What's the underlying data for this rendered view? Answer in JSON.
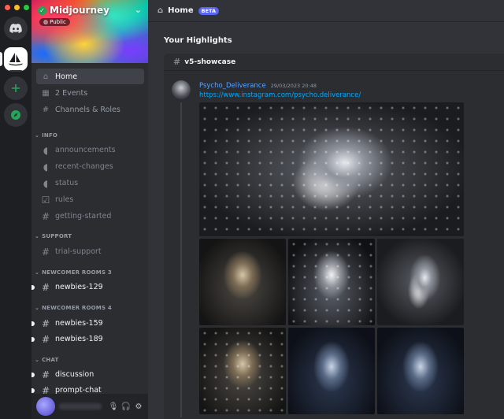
{
  "server": {
    "name": "Midjourney",
    "visibility": "Public"
  },
  "nav": [
    {
      "label": "Home"
    },
    {
      "label": "2 Events"
    },
    {
      "label": "Channels & Roles"
    }
  ],
  "categories": {
    "info": "INFO",
    "support": "SUPPORT",
    "newcomer3": "NEWCOMER ROOMS 3",
    "newcomer4": "NEWCOMER ROOMS 4",
    "chat": "CHAT"
  },
  "channels": {
    "announcements": "announcements",
    "recent_changes": "recent-changes",
    "status": "status",
    "rules": "rules",
    "getting_started": "getting-started",
    "trial_support": "trial-support",
    "newbies_129": "newbies-129",
    "newbies_159": "newbies-159",
    "newbies_189": "newbies-189",
    "discussion": "discussion",
    "prompt_chat": "prompt-chat"
  },
  "topbar": {
    "title": "Home",
    "badge": "BETA"
  },
  "highlights": {
    "title": "Your Highlights",
    "channel": "v5-showcase",
    "message": {
      "author": "Psycho_Deliverance",
      "timestamp": "29/03/2023 20:48",
      "link": "https://www.instagram.com/psycho.deliverance/"
    }
  },
  "colors": {
    "accent": "#5865f2",
    "link": "#00a8fc",
    "author": "#5aa3ff",
    "online": "#23a55a",
    "close": "#ff5f57",
    "minimize": "#febc2e",
    "maximize": "#28c840"
  },
  "icons": [
    "discord-icon",
    "midjourney-icon",
    "add-server-icon",
    "explore-icon",
    "home-icon",
    "calendar-icon",
    "channels-icon",
    "megaphone-icon",
    "hash-icon",
    "checkbox-icon",
    "microphone-icon",
    "headphones-icon",
    "gear-icon",
    "chevron-down-icon"
  ]
}
